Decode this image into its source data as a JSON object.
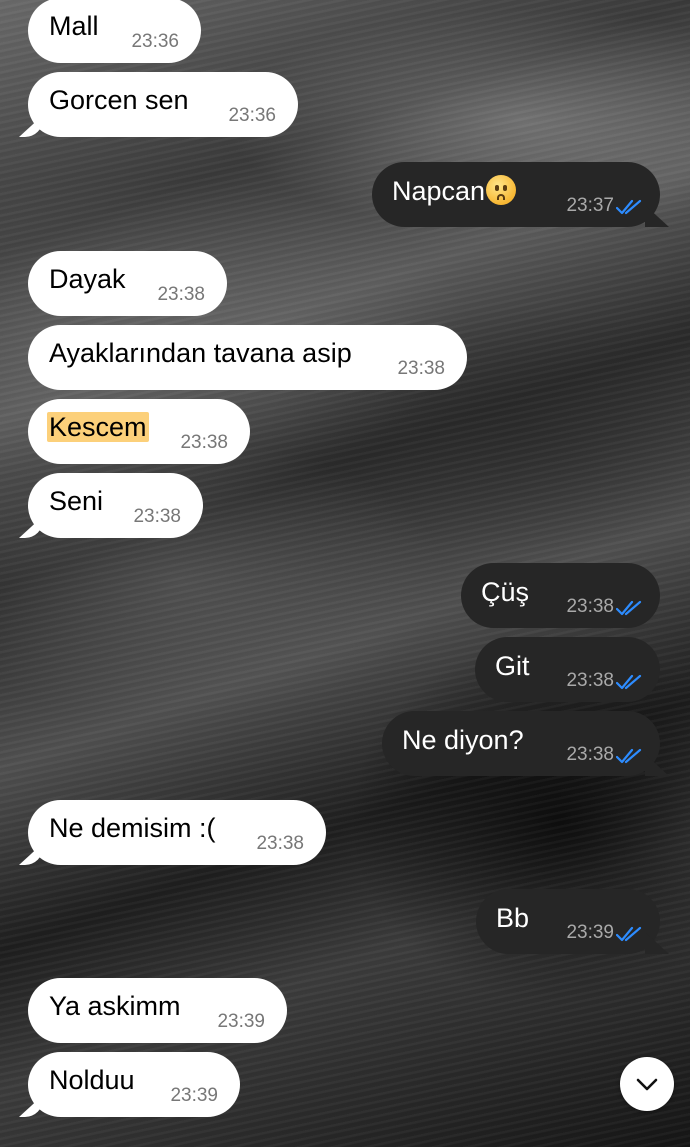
{
  "messages": [
    {
      "text": "Mall",
      "time": "23:36",
      "direction": "in"
    },
    {
      "text": "Gorcen sen",
      "time": "23:36",
      "direction": "in"
    },
    {
      "text": "Napcan",
      "emoji": "anguished-face-emoji",
      "time": "23:37",
      "direction": "out",
      "read": true
    },
    {
      "text": "Dayak",
      "time": "23:38",
      "direction": "in"
    },
    {
      "text": "Ayaklarından tavana asip",
      "time": "23:38",
      "direction": "in"
    },
    {
      "text": "Kescem",
      "time": "23:38",
      "direction": "in",
      "highlighted": true
    },
    {
      "text": "Seni",
      "time": "23:38",
      "direction": "in"
    },
    {
      "text": "Çüş",
      "time": "23:38",
      "direction": "out",
      "read": true
    },
    {
      "text": "Git",
      "time": "23:38",
      "direction": "out",
      "read": true
    },
    {
      "text": "Ne diyon?",
      "time": "23:38",
      "direction": "out",
      "read": true
    },
    {
      "text": "Ne demisim :(",
      "time": "23:38",
      "direction": "in"
    },
    {
      "text": "Bb",
      "time": "23:39",
      "direction": "out",
      "read": true
    },
    {
      "text": "Ya askimm",
      "time": "23:39",
      "direction": "in"
    },
    {
      "text": "Nolduu",
      "time": "23:39",
      "direction": "in"
    }
  ],
  "icons": {
    "read_receipt": "double-check-icon",
    "scroll_down": "chevron-down-icon"
  },
  "colors": {
    "incoming_bubble": "#ffffff",
    "outgoing_bubble": "#262626",
    "read_check": "#2d8cff",
    "highlight": "#fcd07a"
  }
}
